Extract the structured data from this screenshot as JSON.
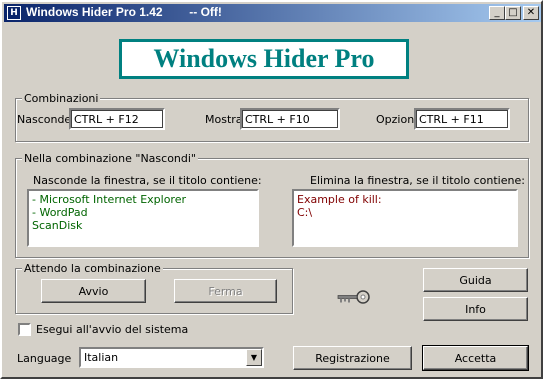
{
  "window": {
    "title": "Windows Hider Pro 1.42        -- Off!",
    "icon_glyph": "H"
  },
  "title_buttons": {
    "minimize": "_",
    "maximize": "□",
    "close": "✕"
  },
  "logo": {
    "text": "Windows Hider Pro"
  },
  "combinazioni": {
    "legend": "Combinazioni",
    "nasconde_label": "Nasconde",
    "nasconde_value": "CTRL + F12",
    "mostra_label": "Mostra",
    "mostra_value": "CTRL + F10",
    "opzioni_label": "Opzioni",
    "opzioni_value": "CTRL + F11"
  },
  "nascondi": {
    "legend": "Nella combinazione \"Nascondi\"",
    "hide_label": "Nasconde la finestra, se il titolo contiene:",
    "hide_items": [
      "- Microsoft Internet Explorer",
      "- WordPad",
      "ScanDisk"
    ],
    "kill_label": "Elimina la finestra, se il titolo contiene:",
    "kill_items": [
      "Example of kill:",
      "C:\\"
    ]
  },
  "attendo": {
    "legend": "Attendo la combinazione",
    "start_button": "Avvio",
    "stop_button": "Ferma"
  },
  "buttons": {
    "guida": "Guida",
    "info": "Info",
    "registrazione": "Registrazione",
    "accetta": "Accetta"
  },
  "startup": {
    "label": "Esegui all'avvio del sistema",
    "checked": false
  },
  "language": {
    "label": "Language",
    "selected": "Italian"
  },
  "icons": {
    "key": "key-icon",
    "dropdown": "chevron-down-icon"
  }
}
